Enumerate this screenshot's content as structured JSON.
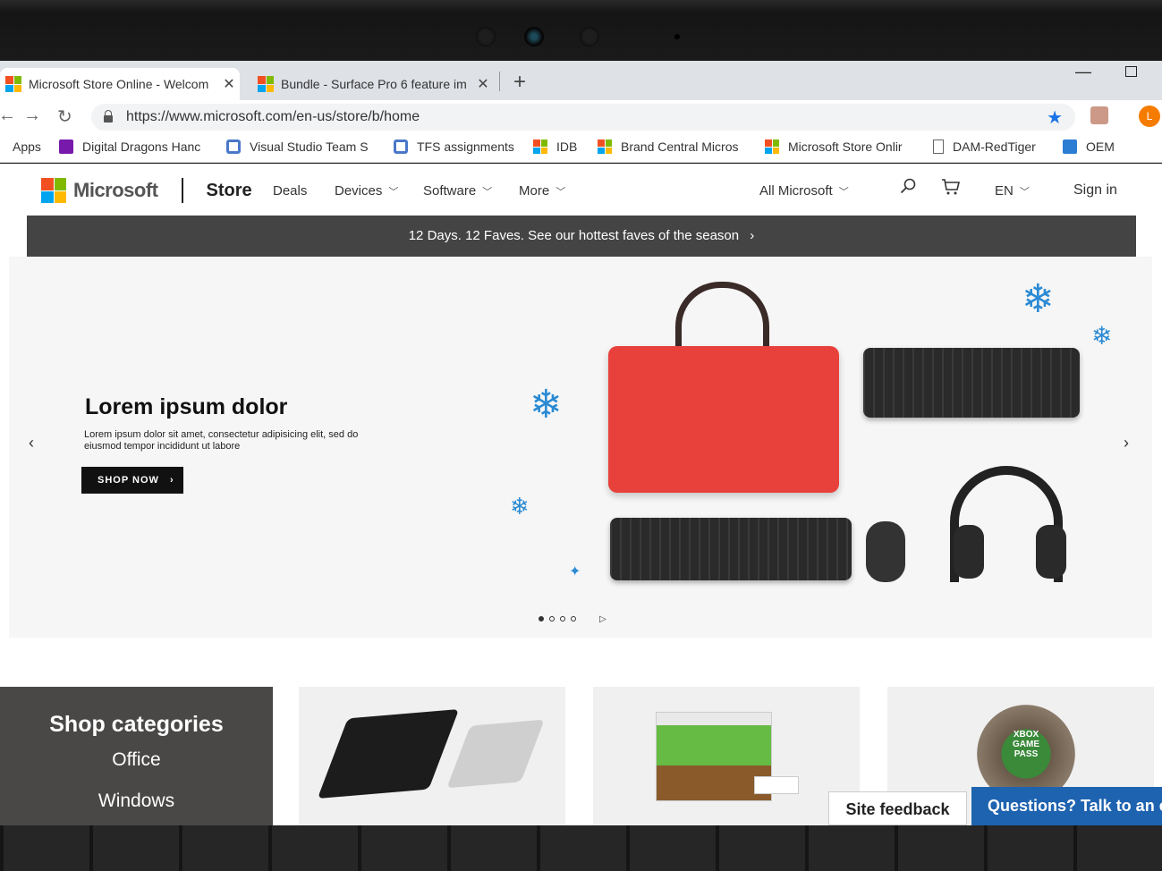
{
  "browser": {
    "tabs": [
      {
        "title": "Microsoft Store Online - Welcom",
        "active": true
      },
      {
        "title": "Bundle - Surface Pro 6 feature im",
        "active": false
      }
    ],
    "new_tab": "+",
    "url": "https://www.microsoft.com/en-us/store/b/home",
    "profile_initial": "L",
    "bookmarks": [
      {
        "label": "Apps",
        "icon": "apps-grid-icon"
      },
      {
        "label": "Digital Dragons Hanc",
        "icon": "onenote-icon"
      },
      {
        "label": "Visual Studio Team S",
        "icon": "visual-studio-icon"
      },
      {
        "label": "TFS assignments",
        "icon": "visual-studio-icon"
      },
      {
        "label": "IDB",
        "icon": "microsoft-logo-icon"
      },
      {
        "label": "Brand Central Micros",
        "icon": "microsoft-logo-icon"
      },
      {
        "label": "Microsoft Store Onlir",
        "icon": "microsoft-logo-icon"
      },
      {
        "label": "DAM-RedTiger",
        "icon": "page-icon"
      },
      {
        "label": "OEM",
        "icon": "sharepoint-icon"
      }
    ]
  },
  "header": {
    "brand": "Microsoft",
    "store": "Store",
    "nav": [
      "Deals",
      "Devices",
      "Software",
      "More"
    ],
    "all_microsoft": "All Microsoft",
    "language": "EN",
    "sign_in": "Sign in"
  },
  "promo": {
    "text": "12 Days. 12 Faves. See our hottest faves of the season",
    "chevron": "›"
  },
  "hero": {
    "title": "Lorem ipsum dolor",
    "description": "Lorem ipsum dolor sit amet, consectetur adipisicing elit, sed do eiusmod tempor incididunt ut labore",
    "cta": "SHOP NOW",
    "cta_chevron": "›",
    "prev": "‹",
    "next": "›",
    "slide_count": 4,
    "current_slide": 1
  },
  "categories": {
    "title": "Shop categories",
    "items": [
      "Office",
      "Windows"
    ]
  },
  "tiles": {
    "gamepass_text": "XBOX GAME PASS"
  },
  "footer_buttons": {
    "feedback": "Site feedback",
    "chat": "Questions? Talk to an e"
  },
  "colors": {
    "promo_bar": "#444444",
    "chat_blue": "#1e63b0",
    "bag_red": "#e8413c",
    "accent_star": "#1a73e8",
    "profile": "#f57c00"
  }
}
